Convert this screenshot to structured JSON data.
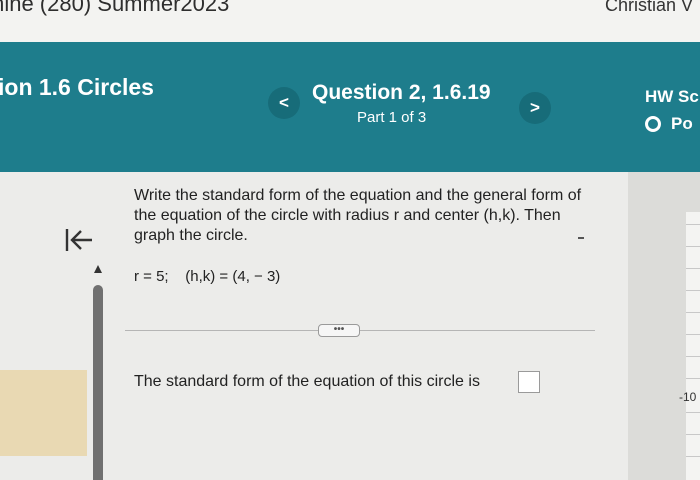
{
  "top": {
    "course": "mine (280) Summer2023",
    "user": "Christian V"
  },
  "header": {
    "section_title": "ion 1.6 Circles",
    "question_title": "Question 2, 1.6.19",
    "part": "Part 1 of 3",
    "prev_glyph": "<",
    "next_glyph": ">",
    "hw_title": "HW Sc",
    "hw_points": "Po"
  },
  "question": {
    "prompt": "Write the standard form of the equation and the general form of the equation of the circle with radius r and center (h,k). Then graph the circle.",
    "given": "r = 5;    (h,k) = (4, − 3)",
    "expand_label": "•••",
    "answer_prompt": "The standard form of the equation of this circle is"
  },
  "graph": {
    "tick_label": "-10"
  },
  "colors": {
    "header_bg": "#1e7d8c",
    "nav_button": "#176c79",
    "highlight_block": "#e9d9b3"
  }
}
